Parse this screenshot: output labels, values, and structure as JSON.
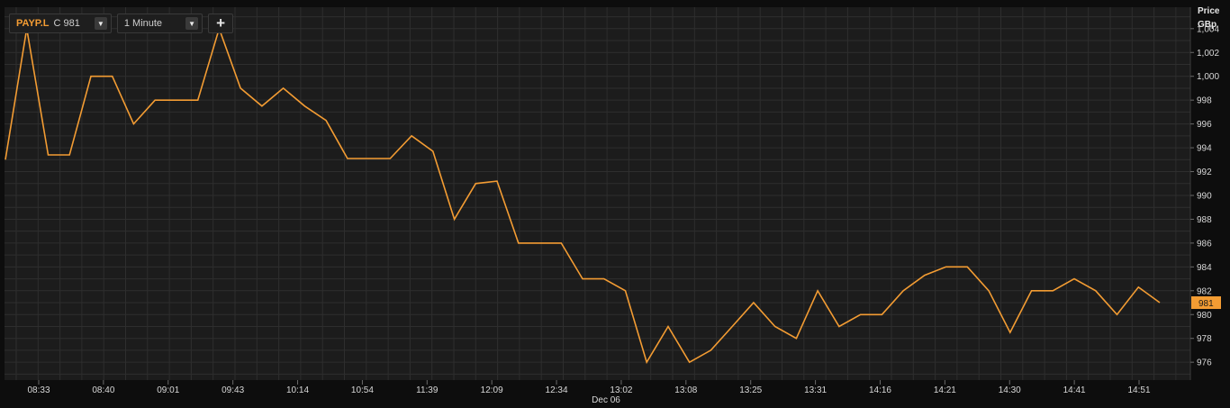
{
  "toolbar": {
    "symbol": "PAYP.L",
    "close_label": "C 981",
    "interval": "1 Minute",
    "symbol_caret": "▼",
    "interval_caret": "▼",
    "add_label": "+"
  },
  "axis": {
    "price_label": "Price",
    "unit_label": "GBp"
  },
  "colors": {
    "line": "#f39c33",
    "grid": "#2e2e2e",
    "plot_bg": "#1c1c1c",
    "text": "#d8d8d8"
  },
  "chart_data": {
    "type": "line",
    "grid": true,
    "ylim": [
      974.5,
      1005.8
    ],
    "yticks": [
      976,
      978,
      980,
      982,
      984,
      986,
      988,
      990,
      992,
      994,
      996,
      998,
      1000,
      1002,
      1004
    ],
    "ytick_labels": [
      "976",
      "978",
      "980",
      "982",
      "984",
      "986",
      "988",
      "990",
      "992",
      "994",
      "996",
      "998",
      "1,000",
      "1,002",
      "1,004"
    ],
    "xtick_labels": [
      "08:33",
      "08:40",
      "09:01",
      "09:43",
      "10:14",
      "10:54",
      "11:39",
      "12:09",
      "12:34",
      "13:02",
      "13:08",
      "13:25",
      "13:31",
      "14:16",
      "14:21",
      "14:30",
      "14:41",
      "14:51"
    ],
    "date_label": "Dec 06",
    "last_price_label": "981",
    "series": [
      {
        "values": [
          993,
          1004,
          993.4,
          993.4,
          1000,
          1000,
          996,
          998,
          998,
          998,
          1004,
          999,
          997.5,
          999,
          997.5,
          996.3,
          993.1,
          993.1,
          993.1,
          995,
          993.7,
          988,
          991,
          991.2,
          986,
          986,
          986,
          983,
          983,
          982,
          976,
          979,
          976,
          977,
          979,
          981,
          979,
          978,
          982,
          979,
          980,
          980,
          982,
          983.3,
          984,
          984,
          982,
          978.5,
          982,
          982,
          983,
          982,
          980,
          982.3,
          981
        ]
      }
    ]
  }
}
